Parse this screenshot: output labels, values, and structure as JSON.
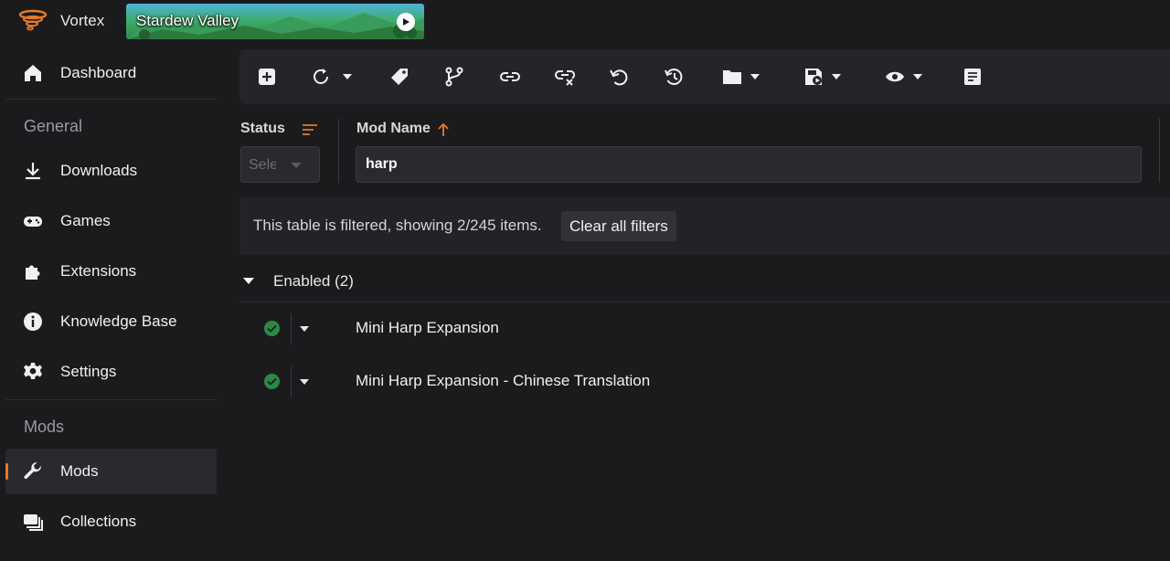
{
  "titlebar": {
    "app_name": "Vortex",
    "game_title": "Stardew Valley"
  },
  "sidebar": {
    "items": [
      {
        "label": "Dashboard",
        "icon": "home-icon"
      },
      {
        "label": "Downloads",
        "icon": "download-icon"
      },
      {
        "label": "Games",
        "icon": "gamepad-icon"
      },
      {
        "label": "Extensions",
        "icon": "puzzle-icon"
      },
      {
        "label": "Knowledge Base",
        "icon": "info-icon"
      },
      {
        "label": "Settings",
        "icon": "gear-icon"
      },
      {
        "label": "Mods",
        "icon": "wrench-icon",
        "active": true
      },
      {
        "label": "Collections",
        "icon": "collections-icon"
      }
    ],
    "sections": {
      "general": "General",
      "mods": "Mods"
    }
  },
  "table": {
    "columns": {
      "status": "Status",
      "mod_name": "Mod Name"
    },
    "status_filter_placeholder": "Select...",
    "name_filter_value": "harp",
    "filter_message": "This table is filtered, showing 2/245 items.",
    "clear_filters_label": "Clear all filters",
    "group_label": "Enabled (2)",
    "rows": [
      {
        "name": "Mini Harp Expansion",
        "status": "enabled"
      },
      {
        "name": "Mini Harp Expansion - Chinese Translation",
        "status": "enabled"
      }
    ]
  },
  "colors": {
    "accent": "#e67a2a",
    "enabled": "#2a8a45",
    "background": "#1b1b1e",
    "toolbar": "#252529"
  }
}
